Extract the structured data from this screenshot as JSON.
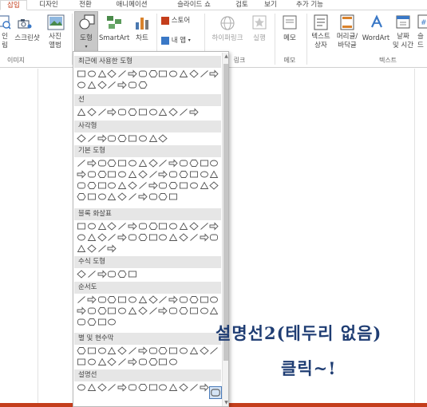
{
  "tabs": [
    {
      "label": "삽입",
      "active": true
    },
    {
      "label": "디자인",
      "active": false
    },
    {
      "label": "전환",
      "active": false
    },
    {
      "label": "애니메이션",
      "active": false
    },
    {
      "label": "슬라이드 쇼",
      "active": false
    },
    {
      "label": "검토",
      "active": false
    },
    {
      "label": "보기",
      "active": false
    },
    {
      "label": "추가 기능",
      "active": false
    }
  ],
  "ribbon": {
    "image_group_label": "이미지",
    "link_group_label": "링크",
    "memo_group_label": "메모",
    "text_group_label": "텍스트",
    "online_image_label": "인라인 이미지",
    "online_image_label_top": "인",
    "online_image_label_bottom": "림",
    "screenshot_label": "스크린샷",
    "photo_album_label_top": "사진",
    "photo_album_label_bottom": "앨범",
    "shapes_label": "도형",
    "smartart_label": "SmartArt",
    "chart_label": "차트",
    "store_label": "스토어",
    "myapps_label": "내 앱",
    "hyperlink_label": "하이퍼링크",
    "action_label": "실행",
    "memo_label": "메모",
    "textbox_label_top": "텍스트",
    "textbox_label_bottom": "상자",
    "header_footer_label_top": "머리글/",
    "header_footer_label_bottom": "바닥글",
    "wordart_label": "WordArt",
    "datetime_label_top": "날짜",
    "datetime_label_bottom": "및 시간",
    "slide_number_label_top": "슬",
    "slide_number_label_bottom": "드"
  },
  "shapes_panel": {
    "sections": [
      {
        "title": "최근에 사용한 도형"
      },
      {
        "title": "선"
      },
      {
        "title": "사각형"
      },
      {
        "title": "기본 도형"
      },
      {
        "title": "블록 화살표"
      },
      {
        "title": "수식 도형"
      },
      {
        "title": "순서도"
      },
      {
        "title": "별 및 현수막"
      },
      {
        "title": "설명선"
      }
    ],
    "selected_shape": "설명선2(테두리 없음)"
  },
  "annotation": {
    "line1": "설명선2(테두리 없음)",
    "line2": "클릭~!"
  },
  "colors": {
    "accent": "#c43e1c",
    "annotation": "#1f3d73",
    "selection": "#4a7ab8"
  }
}
